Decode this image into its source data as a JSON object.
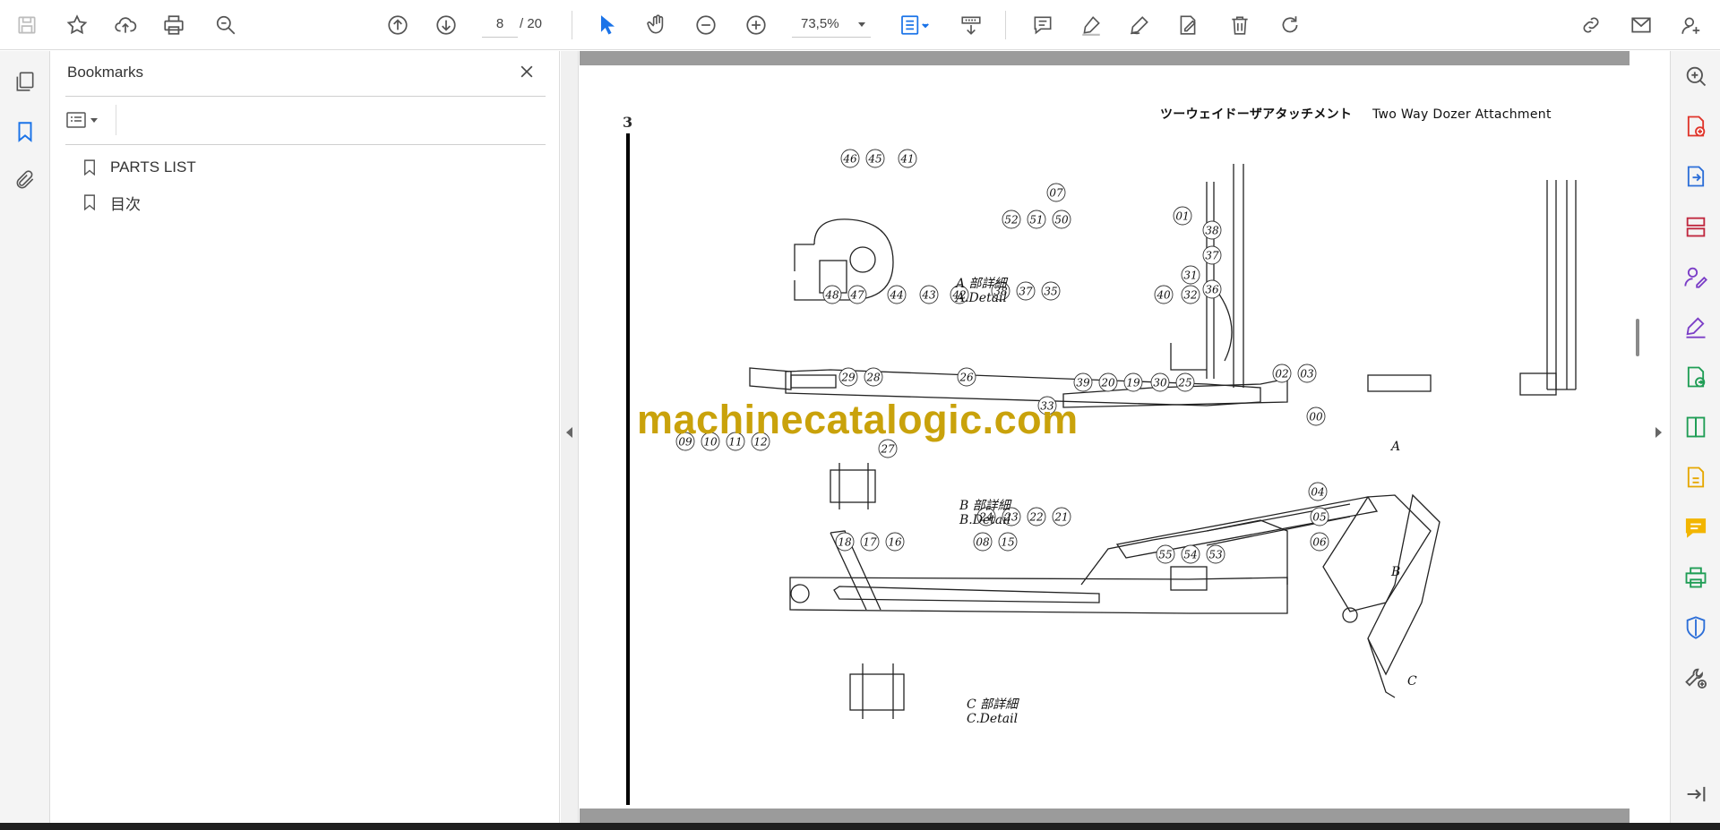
{
  "toolbar": {
    "current_page": "8",
    "page_total": "/  20",
    "zoom": "73,5%"
  },
  "bookmarks": {
    "title": "Bookmarks",
    "items": [
      {
        "label": "PARTS LIST"
      },
      {
        "label": "目次"
      }
    ]
  },
  "document": {
    "page_number": "3",
    "title_jp": "ツーウェイドーザアタッチメント",
    "title_en": "Two Way Dozer Attachment",
    "watermark": "machinecatalogic.com",
    "detail_labels": [
      {
        "jp": "A 部詳細",
        "en": "A.Detail"
      },
      {
        "jp": "B 部詳細",
        "en": "B.Detail"
      },
      {
        "jp": "C 部詳細",
        "en": "C.Detail"
      }
    ],
    "markers": [
      "A",
      "B",
      "C"
    ],
    "callouts": [
      "46",
      "45",
      "41",
      "07",
      "52",
      "51",
      "50",
      "01",
      "38",
      "37",
      "31",
      "36",
      "48",
      "47",
      "44",
      "43",
      "42",
      "38",
      "37",
      "35",
      "40",
      "32",
      "02",
      "03",
      "29",
      "28",
      "26",
      "39",
      "20",
      "19",
      "30",
      "25",
      "33",
      "00",
      "27",
      "09",
      "10",
      "11",
      "12",
      "24",
      "23",
      "22",
      "21",
      "04",
      "05",
      "18",
      "17",
      "16",
      "08",
      "15",
      "06",
      "55",
      "54",
      "53"
    ]
  }
}
